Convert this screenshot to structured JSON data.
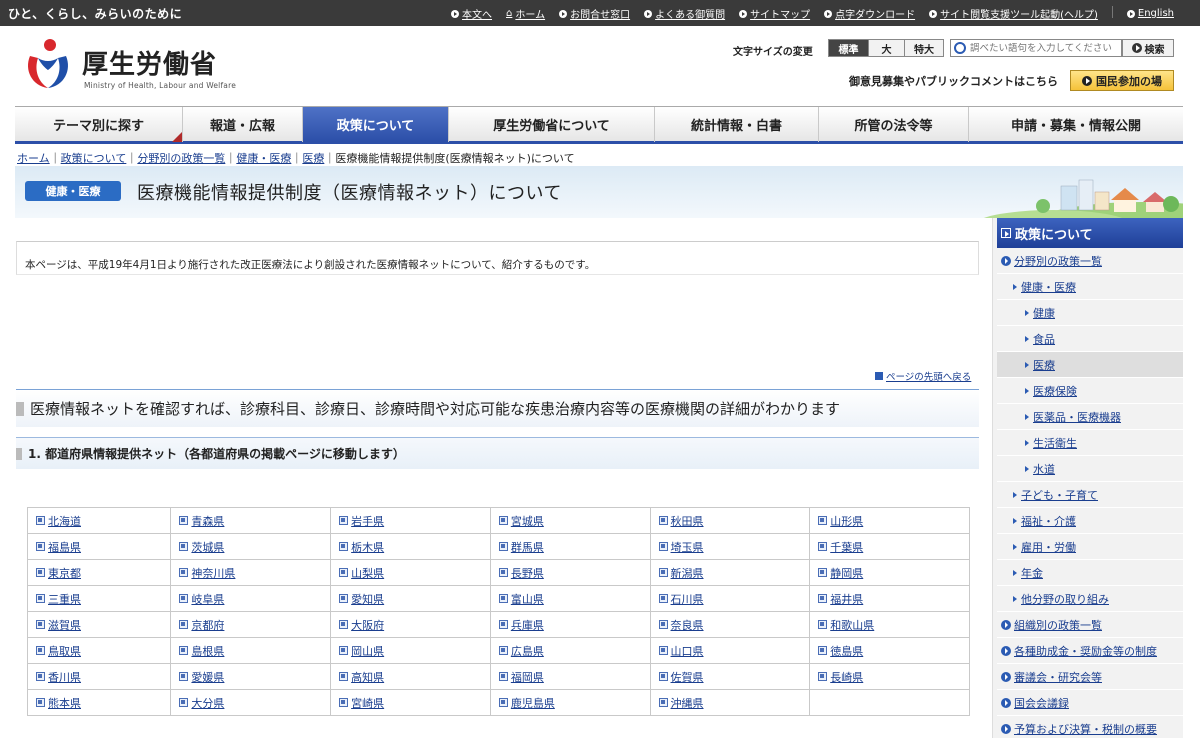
{
  "topbar": {
    "tagline": "ひと、くらし、みらいのために",
    "links": [
      "本文へ",
      "ホーム",
      "お問合せ窓口",
      "よくある御質問",
      "サイトマップ",
      "点字ダウンロード",
      "サイト閲覧支援ツール起動(ヘルプ)"
    ],
    "english": "English"
  },
  "header": {
    "logo_title": "厚生労働省",
    "logo_sub": "Ministry of Health, Labour and Welfare",
    "fontsize_label": "文字サイズの変更",
    "fontsizes": [
      "標準",
      "大",
      "特大"
    ],
    "search_placeholder": "調べたい語句を入力してください",
    "search_button": "検索",
    "opinion_text": "御意見募集やパブリックコメントはこちら",
    "kokumin_button": "国民参加の場"
  },
  "nav": {
    "items": [
      "テーマ別に探す",
      "報道・広報",
      "政策について",
      "厚生労働省について",
      "統計情報・白書",
      "所管の法令等",
      "申請・募集・情報公開"
    ],
    "active_index": 2
  },
  "breadcrumb": {
    "links": [
      "ホーム",
      "政策について",
      "分野別の政策一覧",
      "健康・医療",
      "医療"
    ],
    "current": "医療機能情報提供制度(医療情報ネット)について"
  },
  "title": {
    "badge": "健康・医療",
    "text": "医療機能情報提供制度（医療情報ネット）について"
  },
  "intro": "本ページは、平成19年4月1日より施行された改正医療法により創設された医療情報ネットについて、紹介するものです。",
  "pagetop": "ページの先頭へ戻る",
  "h2": "医療情報ネットを確認すれば、診療科目、診療日、診療時間や対応可能な疾患治療内容等の医療機関の詳細がわかります",
  "h3": "1. 都道府県情報提供ネット（各都道府県の掲載ページに移動します）",
  "prefectures": [
    [
      "北海道",
      "青森県",
      "岩手県",
      "宮城県",
      "秋田県",
      "山形県"
    ],
    [
      "福島県",
      "茨城県",
      "栃木県",
      "群馬県",
      "埼玉県",
      "千葉県"
    ],
    [
      "東京都",
      "神奈川県",
      "山梨県",
      "長野県",
      "新潟県",
      "静岡県"
    ],
    [
      "三重県",
      "岐阜県",
      "愛知県",
      "富山県",
      "石川県",
      "福井県"
    ],
    [
      "滋賀県",
      "京都府",
      "大阪府",
      "兵庫県",
      "奈良県",
      "和歌山県"
    ],
    [
      "鳥取県",
      "島根県",
      "岡山県",
      "広島県",
      "山口県",
      "徳島県"
    ],
    [
      "香川県",
      "愛媛県",
      "高知県",
      "福岡県",
      "佐賀県",
      "長崎県"
    ],
    [
      "熊本県",
      "大分県",
      "宮崎県",
      "鹿児島県",
      "沖縄県",
      ""
    ]
  ],
  "sidebar": {
    "heading": "政策について",
    "items": [
      {
        "label": "分野別の政策一覧",
        "level": 1
      },
      {
        "label": "健康・医療",
        "level": 2
      },
      {
        "label": "健康",
        "level": 3
      },
      {
        "label": "食品",
        "level": 3
      },
      {
        "label": "医療",
        "level": 3
      },
      {
        "label": "医療保険",
        "level": 3
      },
      {
        "label": "医薬品・医療機器",
        "level": 3
      },
      {
        "label": "生活衛生",
        "level": 3
      },
      {
        "label": "水道",
        "level": 3
      },
      {
        "label": "子ども・子育て",
        "level": 2
      },
      {
        "label": "福祉・介護",
        "level": 2
      },
      {
        "label": "雇用・労働",
        "level": 2
      },
      {
        "label": "年金",
        "level": 2
      },
      {
        "label": "他分野の取り組み",
        "level": 2
      },
      {
        "label": "組織別の政策一覧",
        "level": 1
      },
      {
        "label": "各種助成金・奨励金等の制度",
        "level": 1
      },
      {
        "label": "審議会・研究会等",
        "level": 1
      },
      {
        "label": "国会会議録",
        "level": 1
      },
      {
        "label": "予算および決算・税制の概要",
        "level": 1
      }
    ],
    "selected_index": 4
  }
}
